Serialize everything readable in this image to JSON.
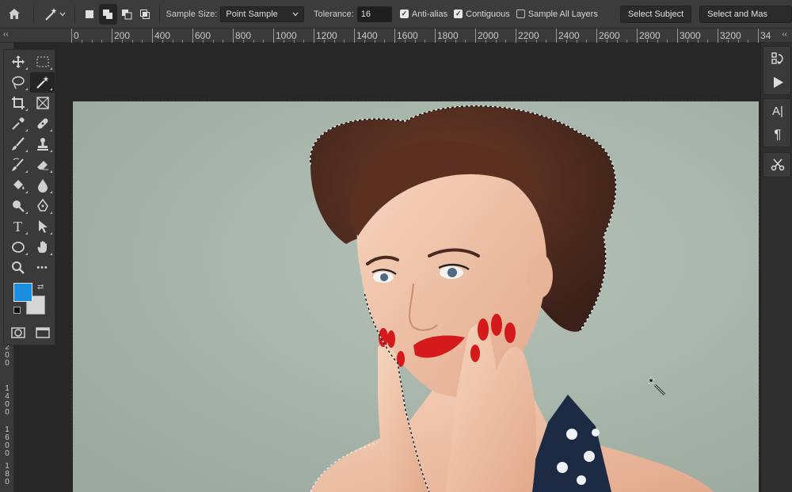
{
  "options_bar": {
    "sample_size_label": "Sample Size:",
    "sample_size_value": "Point Sample",
    "tolerance_label": "Tolerance:",
    "tolerance_value": "16",
    "anti_alias_label": "Anti-alias",
    "anti_alias_checked": true,
    "contiguous_label": "Contiguous",
    "contiguous_checked": true,
    "sample_all_layers_label": "Sample All Layers",
    "sample_all_layers_checked": false,
    "select_subject_label": "Select Subject",
    "select_and_mask_label": "Select and Mas"
  },
  "panel_collapse_left": "‹‹",
  "panel_collapse_right": "‹‹",
  "ruler_top_labels": [
    "0",
    "200",
    "400",
    "600",
    "800",
    "1000",
    "1200",
    "1400",
    "1600",
    "1800",
    "2000",
    "2200",
    "2400",
    "2600",
    "2800",
    "3000",
    "3200",
    "34"
  ],
  "ruler_left_labels": [
    "2\n0\n0",
    "1\n4\n0\n0",
    "1\n6\n0\n0",
    "1\n8\n0"
  ],
  "toolbar": {
    "tools": [
      "move-tool",
      "marquee-tool",
      "lasso-tool",
      "magic-wand-tool",
      "crop-tool",
      "frame-tool",
      "eyedropper-tool",
      "healing-brush-tool",
      "brush-tool",
      "clone-stamp-tool",
      "history-brush-tool",
      "eraser-tool",
      "paint-bucket-tool",
      "blur-tool",
      "dodge-tool",
      "pen-tool",
      "type-tool",
      "path-selection-tool",
      "ellipse-tool",
      "hand-tool",
      "zoom-tool",
      "more-tools"
    ],
    "active_tool": "magic-wand-tool",
    "type_tool_glyph": "T",
    "more_glyph": "•••",
    "foreground_color": "#1a8fe0",
    "background_color": "#d6d6d6"
  },
  "right_panel": {
    "char_glyph": "A|",
    "para_glyph": "¶"
  },
  "colors": {
    "backdrop": "#a8b5ab",
    "hair": "#4a2a1e",
    "skin": "#efc3a6",
    "lips_nails": "#d41a1a",
    "dress": "#1c2a44"
  }
}
